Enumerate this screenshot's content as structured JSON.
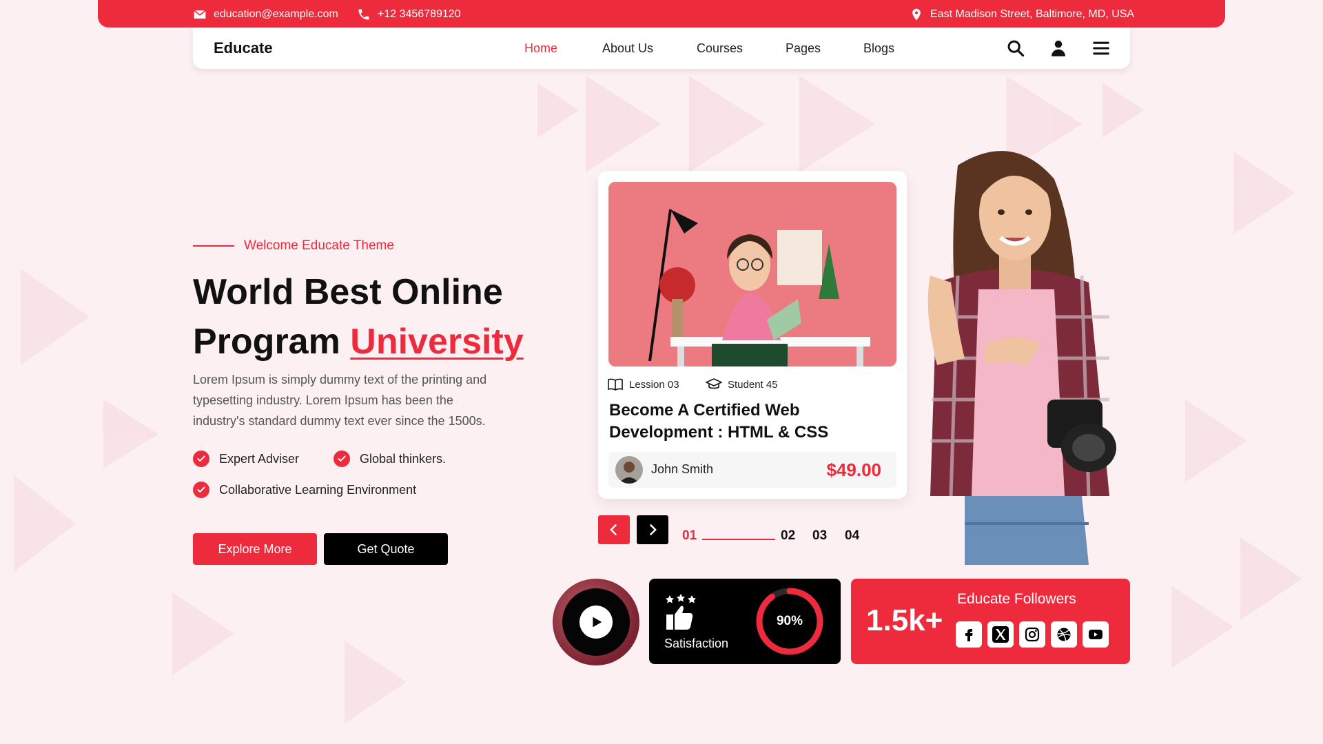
{
  "topbar": {
    "email": "education@example.com",
    "phone": "+12 3456789120",
    "address": "East Madison Street, Baltimore, MD, USA"
  },
  "nav": {
    "logo": "Educate",
    "links": [
      "Home",
      "About Us",
      "Courses",
      "Pages",
      "Blogs"
    ],
    "active": "Home",
    "icons": [
      "search-icon",
      "user-icon",
      "menu-icon"
    ]
  },
  "hero": {
    "tagline": "Welcome Educate Theme",
    "title_line1": "World Best Online",
    "title_line2_plain": "Program",
    "title_line2_accent": "University",
    "description": "Lorem Ipsum is simply dummy text of the printing and typesetting industry. Lorem Ipsum has been the industry's standard dummy text ever since the 1500s.",
    "features": [
      "Expert Adviser",
      "Global thinkers.",
      "Collaborative Learning Environment"
    ],
    "buttons": {
      "primary": "Explore More",
      "secondary": "Get Quote"
    }
  },
  "course_card": {
    "lessons": "Lession 03",
    "students": "Student 45",
    "title": "Become A Certified Web Development : HTML & CSS",
    "author": "John Smith",
    "price": "$49.00"
  },
  "slider": {
    "pages": [
      "01",
      "02",
      "03",
      "04"
    ],
    "active_index": 0
  },
  "stats": {
    "satisfaction_label": "Satisfaction",
    "satisfaction_value": "90%",
    "satisfaction_fraction": 0.9,
    "followers_count": "1.5k+",
    "followers_label": "Educate Followers",
    "social": [
      "facebook-icon",
      "x-icon",
      "instagram-icon",
      "dribbble-icon",
      "youtube-icon"
    ]
  },
  "colors": {
    "accent": "#ee2a3d",
    "background": "#fcf0f3",
    "dark": "#000000"
  }
}
